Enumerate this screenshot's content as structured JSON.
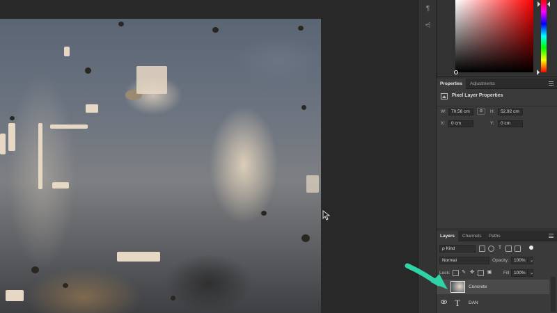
{
  "canvas": {
    "image_name": "Concrete texture"
  },
  "tool_strip": {
    "buttons": [
      {
        "icon": "paragraph-icon",
        "glyph": "¶"
      },
      {
        "icon": "glyph-panel-icon",
        "glyph": "⩤"
      }
    ]
  },
  "properties_panel": {
    "tabs": [
      {
        "label": "Properties"
      },
      {
        "label": "Adjustments"
      }
    ],
    "title": "Pixel Layer Properties",
    "w_label": "W:",
    "w_value": "70.56 cm",
    "h_label": "H:",
    "h_value": "52.92 cm",
    "x_label": "X:",
    "x_value": "0 cm",
    "y_label": "Y:",
    "y_value": "0 cm",
    "link_glyph": "⊖"
  },
  "layers_panel": {
    "tabs": [
      {
        "label": "Layers"
      },
      {
        "label": "Channels"
      },
      {
        "label": "Paths"
      }
    ],
    "filter_label": "ρ Kind",
    "blend_mode": "Normal",
    "opacity_label": "Opacity:",
    "opacity_value": "100%",
    "lock_label": "Lock:",
    "fill_label": "Fill:",
    "fill_value": "100%",
    "layers": [
      {
        "name": "Concrete",
        "type": "pixel",
        "selected": true,
        "visible": true
      },
      {
        "name": "DAN",
        "type": "text",
        "selected": false,
        "visible": true
      }
    ]
  },
  "colors": {
    "annotation_arrow": "#2fd3a6",
    "panel_bg": "#323232",
    "selected_row": "#4a4a4a"
  }
}
